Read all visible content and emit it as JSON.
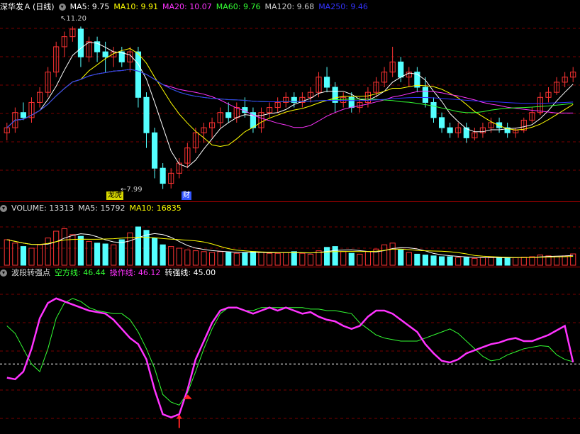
{
  "header": {
    "stock_name": "深华发Ａ",
    "period": "(日线)",
    "ma": [
      {
        "label": "MA5: 9.75",
        "color": "#ffffff"
      },
      {
        "label": "MA10: 9.91",
        "color": "#ffff00"
      },
      {
        "label": "MA20: 10.07",
        "color": "#ff33ff"
      },
      {
        "label": "MA60: 9.76",
        "color": "#33ff33"
      },
      {
        "label": "MA120: 9.68",
        "color": "#cccccc"
      },
      {
        "label": "MA250: 9.46",
        "color": "#3333ff"
      }
    ]
  },
  "price_panel": {
    "high_label": "11.20",
    "low_label": "7.99",
    "tag_dragon": "龙虎",
    "tag_finance": "财"
  },
  "volume_header": {
    "title": "VOLUME: 13313",
    "ma5": "MA5: 15792",
    "ma10": "MA10: 16835"
  },
  "indicator_header": {
    "name": "波段转强点",
    "line1": "空方线: 46.44",
    "line2": "操作线: 46.12",
    "line3": "转强线: 45.00"
  },
  "colors": {
    "up": "#ff3333",
    "down": "#54ffff",
    "grid": "#7a0000",
    "ma5": "#ffffff",
    "ma10": "#ffff00",
    "ma20": "#ff33ff",
    "ma60": "#33ff33",
    "ma250": "#3333ff",
    "bear_line": "#33ff33",
    "op_line": "#ff33ff"
  },
  "chart_data": {
    "type": "candlestick",
    "price": {
      "ylim": [
        7.8,
        11.5
      ],
      "candles": [
        [
          9.1,
          9.3,
          8.95,
          9.2
        ],
        [
          9.2,
          9.6,
          9.1,
          9.5
        ],
        [
          9.5,
          9.7,
          9.35,
          9.4
        ],
        [
          9.4,
          9.8,
          9.3,
          9.7
        ],
        [
          9.7,
          10.0,
          9.6,
          9.9
        ],
        [
          9.9,
          10.4,
          9.8,
          10.3
        ],
        [
          10.3,
          10.9,
          10.2,
          10.8
        ],
        [
          10.8,
          11.1,
          10.6,
          11.0
        ],
        [
          11.0,
          11.2,
          10.9,
          11.15
        ],
        [
          11.15,
          11.2,
          10.4,
          10.6
        ],
        [
          10.6,
          11.0,
          10.5,
          10.9
        ],
        [
          10.9,
          11.0,
          10.5,
          10.7
        ],
        [
          10.7,
          10.9,
          10.3,
          10.6
        ],
        [
          10.6,
          10.8,
          10.4,
          10.7
        ],
        [
          10.7,
          10.8,
          10.4,
          10.5
        ],
        [
          10.5,
          10.8,
          10.3,
          10.7
        ],
        [
          10.7,
          10.8,
          9.6,
          9.8
        ],
        [
          9.8,
          9.9,
          8.8,
          9.1
        ],
        [
          9.1,
          9.2,
          8.2,
          8.4
        ],
        [
          8.4,
          8.5,
          7.99,
          8.1
        ],
        [
          8.1,
          8.4,
          8.0,
          8.3
        ],
        [
          8.3,
          8.6,
          8.2,
          8.5
        ],
        [
          8.5,
          8.9,
          8.4,
          8.8
        ],
        [
          8.8,
          9.2,
          8.7,
          9.1
        ],
        [
          9.1,
          9.3,
          8.9,
          9.2
        ],
        [
          9.2,
          9.4,
          9.0,
          9.3
        ],
        [
          9.3,
          9.6,
          9.2,
          9.5
        ],
        [
          9.5,
          9.7,
          9.3,
          9.4
        ],
        [
          9.4,
          9.7,
          9.3,
          9.6
        ],
        [
          9.6,
          9.8,
          9.4,
          9.5
        ],
        [
          9.5,
          9.6,
          9.1,
          9.2
        ],
        [
          9.2,
          9.6,
          9.1,
          9.5
        ],
        [
          9.5,
          9.7,
          9.4,
          9.6
        ],
        [
          9.6,
          9.8,
          9.5,
          9.7
        ],
        [
          9.7,
          9.9,
          9.6,
          9.8
        ],
        [
          9.8,
          9.9,
          9.6,
          9.7
        ],
        [
          9.7,
          9.9,
          9.6,
          9.8
        ],
        [
          9.8,
          10.0,
          9.7,
          9.9
        ],
        [
          9.9,
          10.3,
          9.8,
          10.2
        ],
        [
          10.2,
          10.4,
          9.9,
          10.0
        ],
        [
          10.0,
          10.1,
          9.5,
          9.7
        ],
        [
          9.7,
          9.9,
          9.6,
          9.8
        ],
        [
          9.8,
          9.9,
          9.5,
          9.6
        ],
        [
          9.6,
          9.8,
          9.5,
          9.7
        ],
        [
          9.7,
          10.0,
          9.6,
          9.9
        ],
        [
          9.9,
          10.2,
          9.8,
          10.1
        ],
        [
          10.1,
          10.4,
          10.0,
          10.3
        ],
        [
          10.3,
          10.8,
          10.2,
          10.5
        ],
        [
          10.5,
          10.6,
          10.1,
          10.2
        ],
        [
          10.2,
          10.4,
          10.0,
          10.3
        ],
        [
          10.3,
          10.4,
          9.9,
          10.0
        ],
        [
          10.0,
          10.2,
          9.6,
          9.7
        ],
        [
          9.7,
          9.8,
          9.3,
          9.4
        ],
        [
          9.4,
          9.5,
          9.1,
          9.2
        ],
        [
          9.2,
          9.3,
          9.0,
          9.1
        ],
        [
          9.1,
          9.3,
          9.0,
          9.2
        ],
        [
          9.2,
          9.3,
          8.9,
          9.0
        ],
        [
          9.0,
          9.2,
          8.95,
          9.1
        ],
        [
          9.1,
          9.3,
          9.0,
          9.2
        ],
        [
          9.2,
          9.4,
          9.1,
          9.3
        ],
        [
          9.3,
          9.4,
          9.1,
          9.2
        ],
        [
          9.2,
          9.3,
          9.0,
          9.1
        ],
        [
          9.1,
          9.2,
          9.0,
          9.15
        ],
        [
          9.15,
          9.4,
          9.1,
          9.35
        ],
        [
          9.35,
          9.6,
          9.3,
          9.5
        ],
        [
          9.5,
          9.9,
          9.45,
          9.8
        ],
        [
          9.8,
          10.0,
          9.7,
          9.9
        ],
        [
          9.9,
          10.2,
          9.85,
          10.1
        ],
        [
          10.1,
          10.3,
          10.0,
          10.2
        ],
        [
          10.2,
          10.4,
          10.1,
          10.3
        ]
      ]
    },
    "volume": {
      "ylim": [
        0,
        60000
      ],
      "values": [
        30000,
        26000,
        22000,
        20000,
        24000,
        32000,
        40000,
        43000,
        36000,
        34000,
        28000,
        26000,
        25000,
        24000,
        30000,
        38000,
        45000,
        41000,
        32000,
        24000,
        22000,
        20000,
        18000,
        17000,
        16000,
        15000,
        16000,
        15000,
        14000,
        15000,
        16000,
        15000,
        14000,
        14000,
        15000,
        16000,
        14000,
        13000,
        17000,
        21000,
        22000,
        16000,
        14000,
        13000,
        16000,
        19000,
        24000,
        26000,
        18000,
        15000,
        13000,
        12000,
        11000,
        10000,
        10000,
        9000,
        9000,
        8000,
        9000,
        9500,
        9000,
        8500,
        9000,
        9500,
        10000,
        12000,
        11000,
        10500,
        11000,
        13313
      ]
    },
    "indicator": {
      "ylim": [
        0,
        100
      ],
      "strong_line": 45.0,
      "bear_line": [
        70,
        65,
        55,
        45,
        40,
        55,
        75,
        85,
        88,
        86,
        82,
        80,
        79,
        78,
        78,
        74,
        66,
        55,
        42,
        25,
        20,
        18,
        26,
        40,
        55,
        68,
        78,
        82,
        82,
        80,
        80,
        82,
        82,
        82,
        82,
        82,
        82,
        81,
        81,
        80,
        80,
        79,
        78,
        72,
        68,
        64,
        62,
        61,
        60,
        60,
        60,
        62,
        64,
        66,
        68,
        65,
        60,
        55,
        50,
        47,
        48,
        51,
        53,
        55,
        56,
        57,
        56.5,
        51,
        48,
        46.44
      ],
      "op_line": [
        36,
        35,
        40,
        55,
        75,
        85,
        88,
        86,
        84,
        82,
        80,
        79,
        78,
        74,
        68,
        62,
        58,
        48,
        28,
        12,
        10,
        12,
        28,
        48,
        60,
        72,
        80,
        82,
        82,
        80,
        78,
        80,
        82,
        80,
        82,
        80,
        78,
        79,
        76,
        74,
        73,
        70,
        68,
        70,
        76,
        80,
        80,
        78,
        74,
        70,
        66,
        58,
        52,
        47,
        46,
        48,
        52,
        54,
        56,
        58,
        59,
        61,
        62,
        60,
        60,
        62,
        64,
        67,
        70,
        46.12
      ]
    }
  }
}
